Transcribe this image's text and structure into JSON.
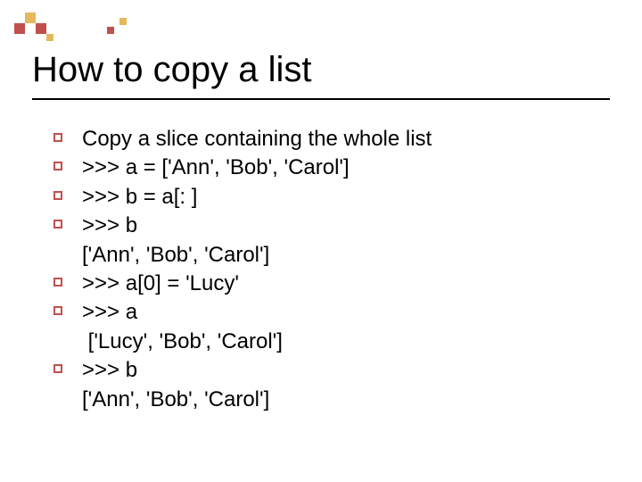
{
  "title": "How to copy a list",
  "bullets": [
    {
      "text": "Copy a slice containing the whole list"
    },
    {
      "text": ">>> a = ['Ann', 'Bob', 'Carol']"
    },
    {
      "text": ">>> b = a[: ]"
    },
    {
      "text": ">>> b",
      "cont": "['Ann', 'Bob', 'Carol']"
    },
    {
      "text": ">>> a[0] = 'Lucy'"
    },
    {
      "text": ">>> a",
      "cont": " ['Lucy', 'Bob', 'Carol']"
    },
    {
      "text": ">>> b",
      "cont": "['Ann', 'Bob', 'Carol']"
    }
  ]
}
